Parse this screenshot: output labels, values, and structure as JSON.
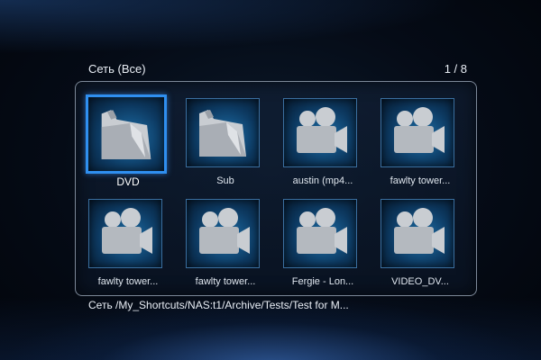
{
  "header": {
    "title": "Сеть (Все)",
    "page_counter": "1 / 8"
  },
  "grid": {
    "items": [
      {
        "label": "DVD",
        "icon": "folder-icon",
        "selected": true
      },
      {
        "label": "Sub",
        "icon": "folder-icon",
        "selected": false
      },
      {
        "label": "austin (mp4...",
        "icon": "video-camera-icon",
        "selected": false
      },
      {
        "label": "fawlty tower...",
        "icon": "video-camera-icon",
        "selected": false
      },
      {
        "label": "fawlty tower...",
        "icon": "video-camera-icon",
        "selected": false
      },
      {
        "label": "fawlty tower...",
        "icon": "video-camera-icon",
        "selected": false
      },
      {
        "label": "Fergie - Lon...",
        "icon": "video-camera-icon",
        "selected": false
      },
      {
        "label": "VIDEO_DV...",
        "icon": "video-camera-icon",
        "selected": false
      }
    ]
  },
  "path_bar": {
    "text": "Сеть /My_Shortcuts/NAS:t1/Archive/Tests/Test for M..."
  },
  "colors": {
    "selection": "#2f8ff0",
    "panel_border": "#7c8898",
    "thumb_bg": "#1d6fa8"
  }
}
